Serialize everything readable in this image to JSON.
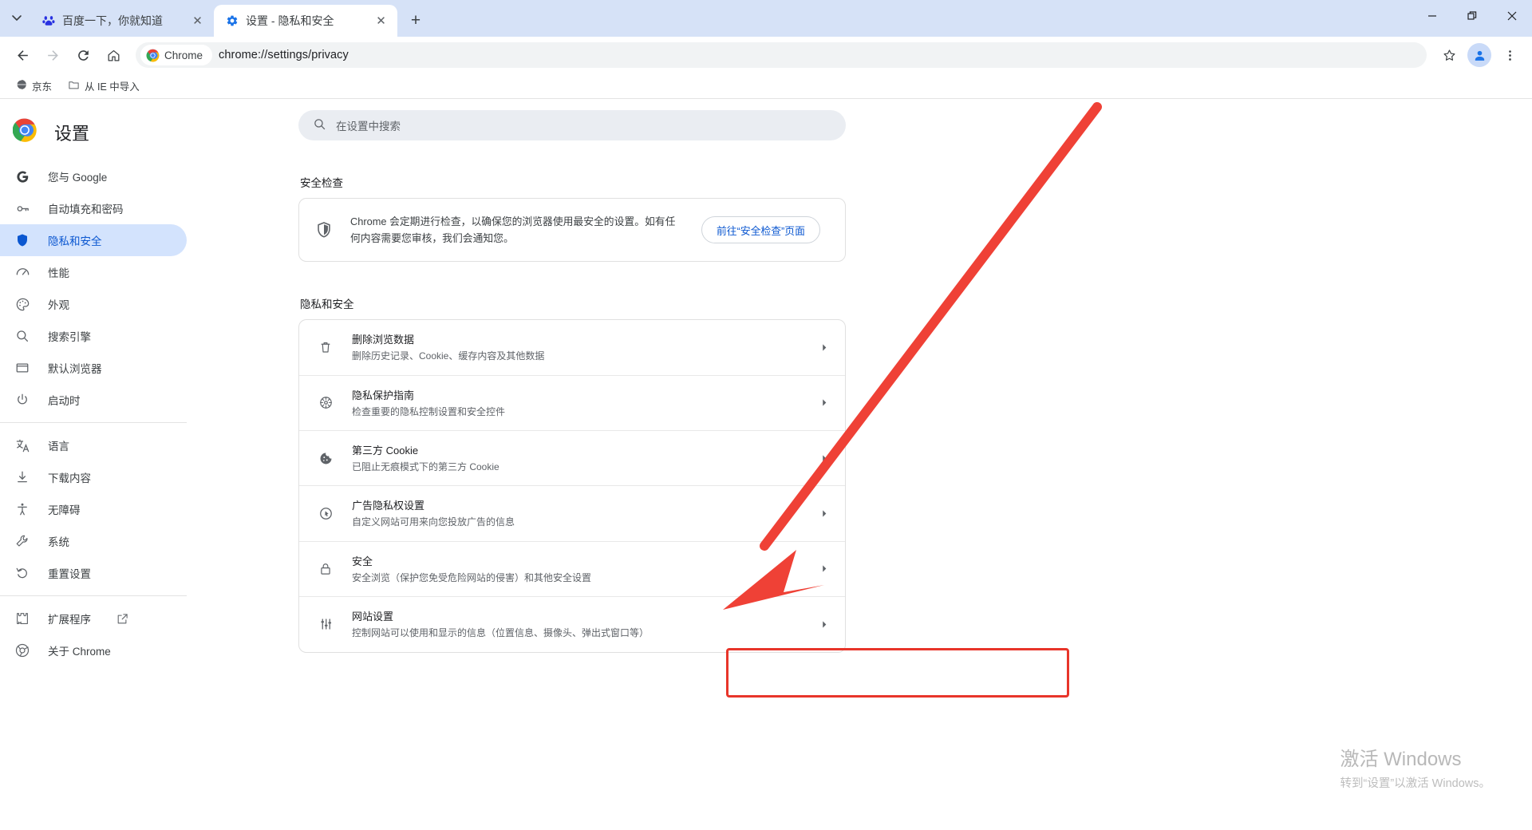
{
  "window": {
    "controls": {
      "minimize": "−",
      "maximize": "❐",
      "close": "✕"
    },
    "tab_list_label": "搜索标签页"
  },
  "tabs": [
    {
      "title": "百度一下，你就知道",
      "favicon": "baidu-icon",
      "active": false,
      "close": "✕"
    },
    {
      "title": "设置 - 隐私和安全",
      "favicon": "gear-icon",
      "active": true,
      "close": "✕"
    }
  ],
  "newtab_label": "+",
  "toolbar": {
    "back": "←",
    "forward": "→",
    "reload": "⟳",
    "home": "⌂",
    "chip_label": "Chrome",
    "url": "chrome://settings/privacy",
    "bookmark_star": "☆",
    "profile": "profile-avatar",
    "menu": "⋮"
  },
  "bookmarks": [
    {
      "label": "京东",
      "icon": "globe-icon"
    },
    {
      "label": "从 IE 中导入",
      "icon": "folder-icon"
    }
  ],
  "settings": {
    "title": "设置",
    "logo": "chrome-logo",
    "search": {
      "placeholder": "在设置中搜索",
      "icon": "search-icon"
    },
    "nav": [
      {
        "label": "您与 Google",
        "icon": "google-g-icon",
        "selected": false
      },
      {
        "label": "自动填充和密码",
        "icon": "key-icon",
        "selected": false
      },
      {
        "label": "隐私和安全",
        "icon": "shield-icon",
        "selected": true
      },
      {
        "label": "性能",
        "icon": "speedometer-icon",
        "selected": false
      },
      {
        "label": "外观",
        "icon": "palette-icon",
        "selected": false
      },
      {
        "label": "搜索引擎",
        "icon": "search-icon",
        "selected": false
      },
      {
        "label": "默认浏览器",
        "icon": "window-icon",
        "selected": false
      },
      {
        "label": "启动时",
        "icon": "power-icon",
        "selected": false
      },
      {
        "label": "语言",
        "icon": "translate-icon",
        "selected": false
      },
      {
        "label": "下载内容",
        "icon": "download-icon",
        "selected": false
      },
      {
        "label": "无障碍",
        "icon": "accessibility-icon",
        "selected": false
      },
      {
        "label": "系统",
        "icon": "wrench-icon",
        "selected": false
      },
      {
        "label": "重置设置",
        "icon": "restore-icon",
        "selected": false
      },
      {
        "label": "扩展程序",
        "icon": "puzzle-icon",
        "external": "open-in-new-icon",
        "selected": false
      },
      {
        "label": "关于 Chrome",
        "icon": "chrome-logo-icon",
        "selected": false
      }
    ]
  },
  "main": {
    "safety_check": {
      "section_title": "安全检查",
      "icon": "shield-icon",
      "description": "Chrome 会定期进行检查，以确保您的浏览器使用最安全的设置。如有任何内容需要您审核，我们会通知您。",
      "button_label": "前往“安全检查”页面"
    },
    "privacy": {
      "section_title": "隐私和安全",
      "rows": [
        {
          "title": "删除浏览数据",
          "subtitle": "删除历史记录、Cookie、缓存内容及其他数据",
          "icon": "trash-icon",
          "arrow": "▸"
        },
        {
          "title": "隐私保护指南",
          "subtitle": "检查重要的隐私控制设置和安全控件",
          "icon": "privacy-guide-icon",
          "arrow": "▸"
        },
        {
          "title": "第三方 Cookie",
          "subtitle": "已阻止无痕模式下的第三方 Cookie",
          "icon": "cookie-icon",
          "arrow": "▸"
        },
        {
          "title": "广告隐私权设置",
          "subtitle": "自定义网站可用来向您投放广告的信息",
          "icon": "ad-privacy-icon",
          "arrow": "▸"
        },
        {
          "title": "安全",
          "subtitle": "安全浏览（保护您免受危险网站的侵害）和其他安全设置",
          "icon": "lock-icon",
          "arrow": "▸"
        },
        {
          "title": "网站设置",
          "subtitle": "控制网站可以使用和显示的信息（位置信息、摄像头、弹出式窗口等）",
          "icon": "sliders-icon",
          "arrow": "▸",
          "highlighted": true
        }
      ]
    }
  },
  "annotation": {
    "color": "#e8352a",
    "shape": "arrow-pointing-to-site-settings-row"
  },
  "watermark": {
    "title": "激活 Windows",
    "subtitle": "转到“设置”以激活 Windows。"
  }
}
